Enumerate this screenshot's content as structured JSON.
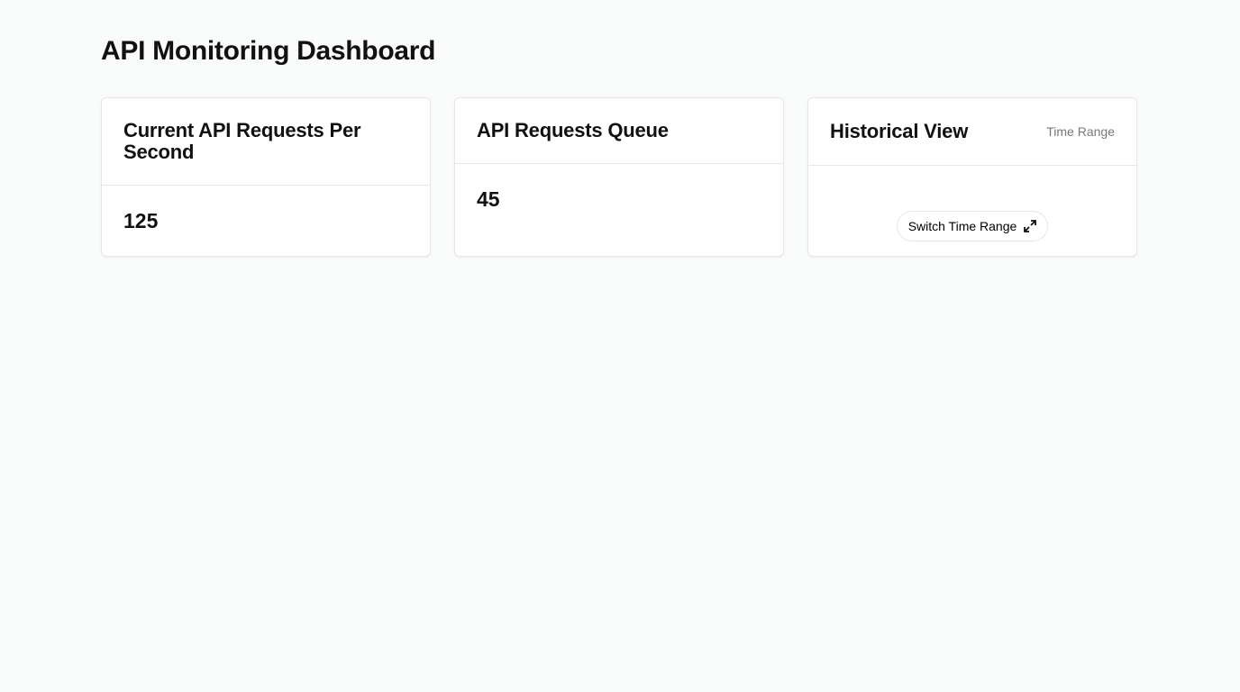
{
  "page": {
    "title": "API Monitoring Dashboard"
  },
  "cards": [
    {
      "title": "Current API Requests Per Second",
      "value": "125"
    },
    {
      "title": "API Requests Queue",
      "value": "45"
    },
    {
      "title": "Historical View",
      "subtitle": "Time Range",
      "button_label": "Switch Time Range",
      "button_icon": "expand-icon"
    }
  ]
}
